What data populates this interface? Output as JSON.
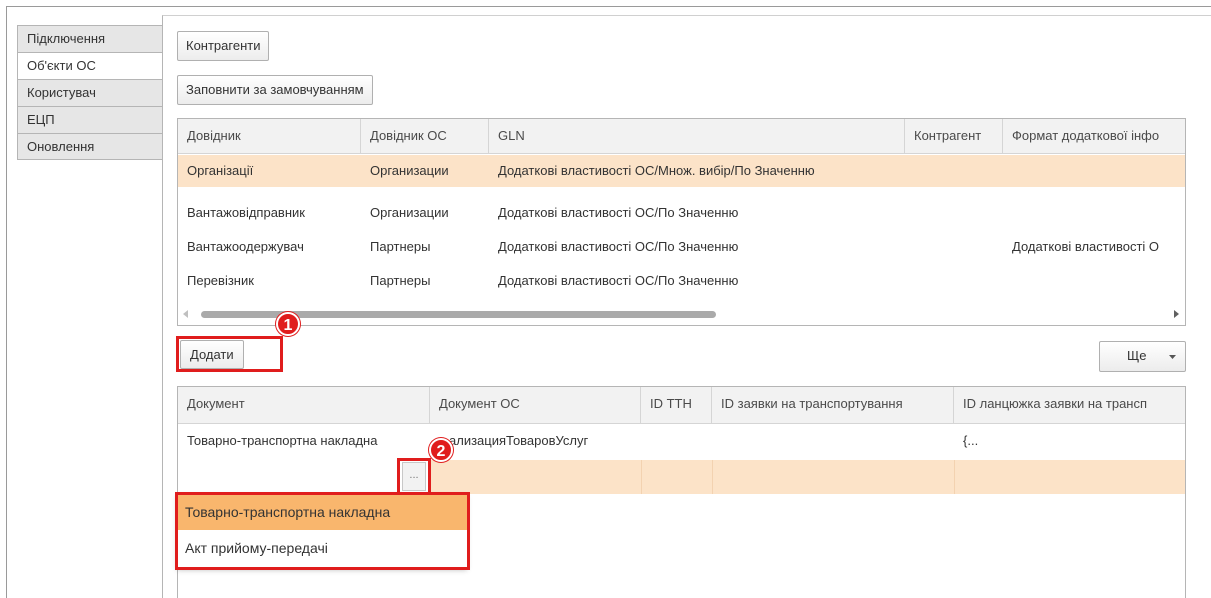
{
  "sidebar": {
    "tabs": [
      {
        "label": "Підключення"
      },
      {
        "label": "Об'єкти ОС"
      },
      {
        "label": "Користувач"
      },
      {
        "label": "ЕЦП"
      },
      {
        "label": "Оновлення"
      }
    ]
  },
  "toolbar": {
    "counterparties_label": "Контрагенти",
    "fill_default_label": "Заповнити за замовчуванням",
    "add_label": "Додати",
    "more_label": "Ще"
  },
  "top_table": {
    "columns": [
      "Довідник",
      "Довідник ОС",
      "GLN",
      "Контрагент",
      "Формат додаткової інфо"
    ],
    "rows": [
      [
        "Організації",
        "Организации",
        "Додаткові властивості ОС/Множ. вибір/По Значенню",
        "",
        ""
      ],
      [
        "Вантажовідправник",
        "Организации",
        "Додаткові властивості ОС/По Значенню",
        "",
        ""
      ],
      [
        "Вантажоодержувач",
        "Партнеры",
        "Додаткові властивості ОС/По Значенню",
        "",
        "Додаткові властивості О"
      ],
      [
        "Перевізник",
        "Партнеры",
        "Додаткові властивості ОС/По Значенню",
        "",
        ""
      ]
    ]
  },
  "bottom_table": {
    "columns": [
      "Документ",
      "Документ ОС",
      "ID ТТН",
      "ID заявки на транспортування",
      "ID ланцюжка заявки на трансп"
    ],
    "rows": [
      [
        "Товарно-транспортна накладна",
        "ализацияТоваровУслуг",
        "",
        "",
        "{..."
      ]
    ],
    "ellipsis": "..."
  },
  "dropdown": {
    "items": [
      {
        "label": "Товарно-транспортна накладна"
      },
      {
        "label": "Акт прийому-передачі"
      }
    ]
  },
  "markers": [
    "1",
    "2"
  ],
  "colors": {
    "highlight": "#fce3c8",
    "dropdown_selected": "#f9b66d",
    "callout": "#e01d1d"
  }
}
